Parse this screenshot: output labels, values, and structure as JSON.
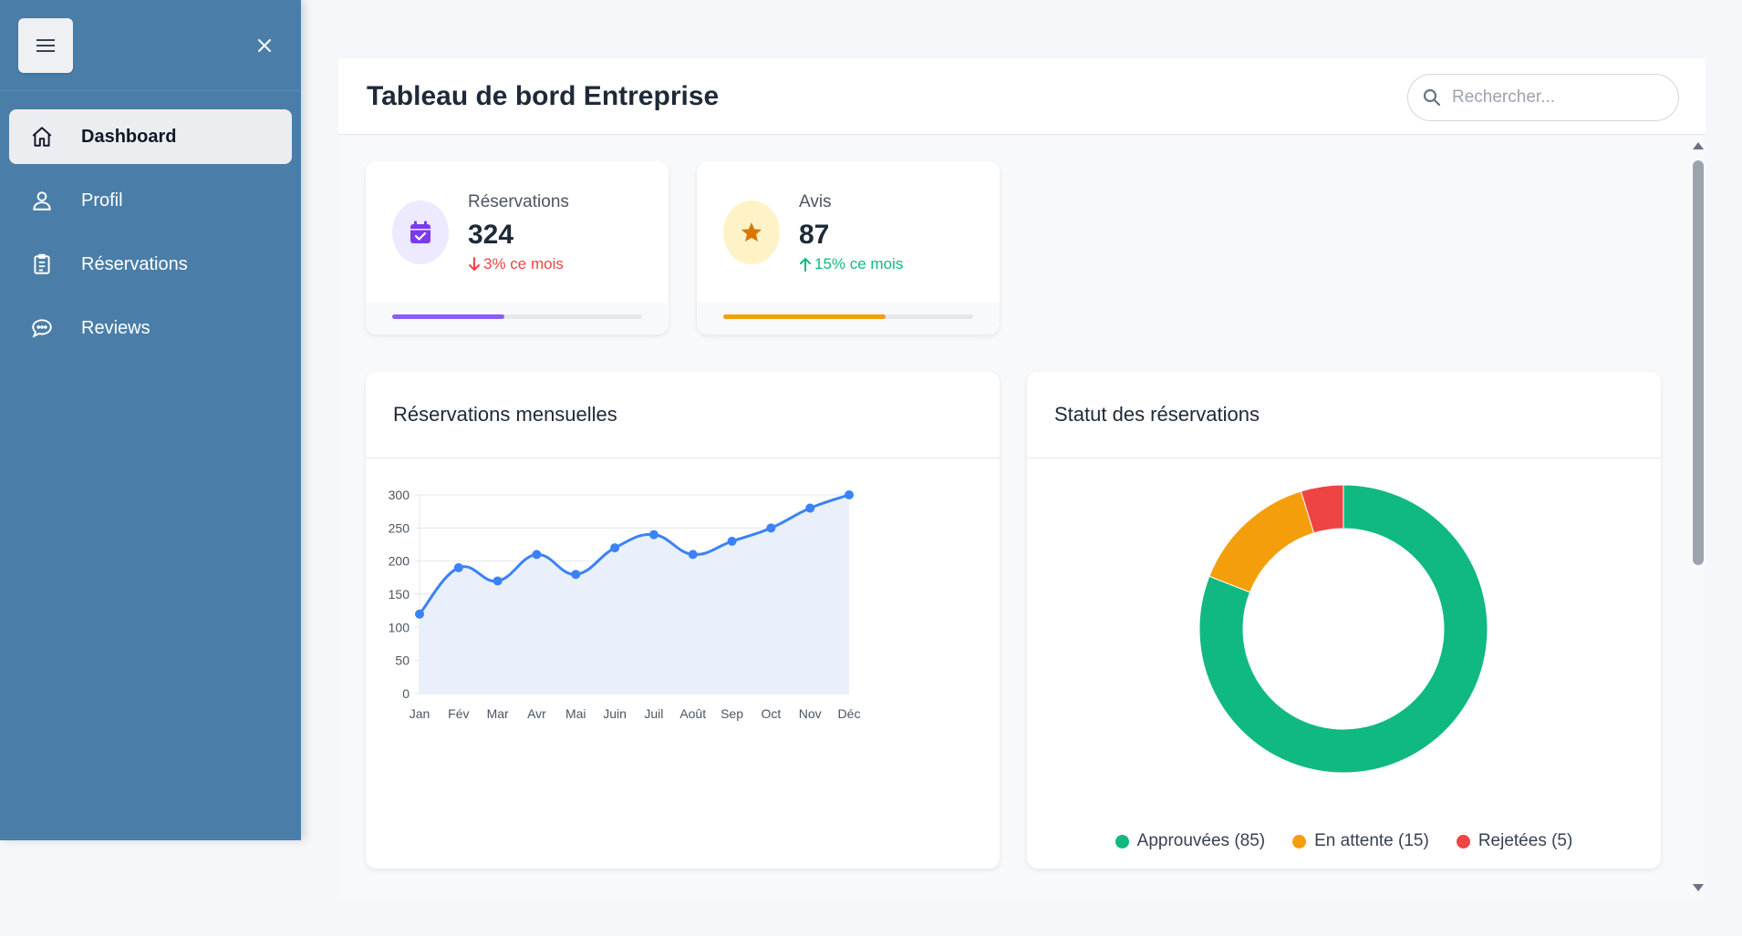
{
  "sidebar": {
    "items": [
      {
        "label": "Dashboard",
        "icon": "home-icon",
        "active": true
      },
      {
        "label": "Profil",
        "icon": "user-icon",
        "active": false
      },
      {
        "label": "Réservations",
        "icon": "clipboard-icon",
        "active": false
      },
      {
        "label": "Reviews",
        "icon": "chat-icon",
        "active": false
      }
    ]
  },
  "header": {
    "title": "Tableau de bord Entreprise",
    "search_placeholder": "Rechercher..."
  },
  "stats": [
    {
      "label": "Réservations",
      "value": "324",
      "trend": "3% ce mois",
      "trend_direction": "down",
      "trend_color": "#ef4444",
      "icon": "calendar-check-icon",
      "accent": "#7c3aed",
      "icon_bg": "#ede9fe",
      "bar_color": "#8b5cf6",
      "progress": 0.45
    },
    {
      "label": "Avis",
      "value": "87",
      "trend": "15% ce mois",
      "trend_direction": "up",
      "trend_color": "#10b981",
      "icon": "star-icon",
      "accent": "#d97706",
      "icon_bg": "#fef3c7",
      "bar_color": "#f59e0b",
      "progress": 0.65
    }
  ],
  "line_chart": {
    "title": "Réservations mensuelles"
  },
  "donut_chart": {
    "title": "Statut des réservations"
  },
  "chart_data": [
    {
      "type": "line",
      "title": "Réservations mensuelles",
      "categories": [
        "Jan",
        "Fév",
        "Mar",
        "Avr",
        "Mai",
        "Juin",
        "Juil",
        "Août",
        "Sep",
        "Oct",
        "Nov",
        "Déc"
      ],
      "values": [
        120,
        190,
        170,
        210,
        180,
        220,
        240,
        210,
        230,
        250,
        280,
        300
      ],
      "ylim": [
        0,
        300
      ],
      "yticks": [
        0,
        50,
        100,
        150,
        200,
        250,
        300
      ],
      "grid": true,
      "color": "#3b82f6",
      "fill": "#eaf0fb"
    },
    {
      "type": "pie",
      "title": "Statut des réservations",
      "categories": [
        "Approuvées (85)",
        "En attente (15)",
        "Rejetées (5)"
      ],
      "values": [
        85,
        15,
        5
      ],
      "colors": [
        "#10b981",
        "#f59e0b",
        "#ef4444"
      ],
      "legend": "bottom"
    }
  ]
}
